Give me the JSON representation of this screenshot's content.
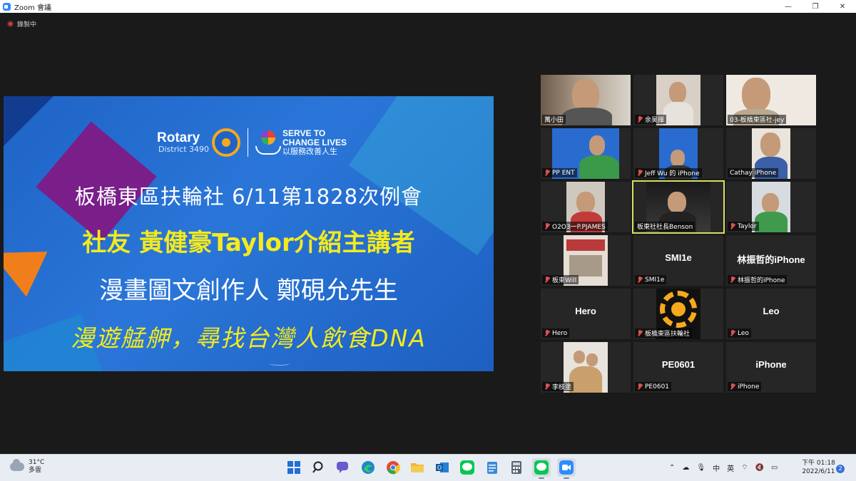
{
  "window": {
    "title": "Zoom 會議",
    "minimize": "—",
    "maximize": "❐",
    "close": "✕"
  },
  "recording": {
    "label": "錄製中"
  },
  "slide": {
    "rotary_name": "Rotary",
    "district": "District 3490",
    "serve_line1": "SERVE TO",
    "serve_line2": "CHANGE LIVES",
    "serve_line3": "以服務改善人生",
    "line1": "板橋東區扶輪社  6/11第1828次例會",
    "line2": "社友 黃健豪Taylor介紹主講者",
    "line3": "漫畫圖文創作人 鄭硯允先生",
    "line4": "漫遊艋舺，尋找台灣人飲食DNA"
  },
  "participants": [
    {
      "name": "萬小田",
      "muted": false,
      "center": ""
    },
    {
      "name": "余昊揮",
      "muted": true,
      "center": ""
    },
    {
      "name": "03-板橋東區社-jey",
      "muted": false,
      "center": ""
    },
    {
      "name": "PP ENT",
      "muted": true,
      "center": ""
    },
    {
      "name": "Jeff Wu 的 iPhone",
      "muted": true,
      "center": ""
    },
    {
      "name": "Cathay iPhone",
      "muted": false,
      "center": ""
    },
    {
      "name": "O2O3一P.PJAMES",
      "muted": true,
      "center": ""
    },
    {
      "name": "板東社社長Benson",
      "muted": false,
      "center": ""
    },
    {
      "name": "Taylor",
      "muted": true,
      "center": ""
    },
    {
      "name": "板東Will",
      "muted": true,
      "center": ""
    },
    {
      "name": "SMI1e",
      "muted": true,
      "center": "SMI1e"
    },
    {
      "name": "林振哲的iPhone",
      "muted": true,
      "center": "林振哲的iPhone"
    },
    {
      "name": "Hero",
      "muted": true,
      "center": "Hero"
    },
    {
      "name": "板橋東區扶輪社",
      "muted": true,
      "center": ""
    },
    {
      "name": "Leo",
      "muted": true,
      "center": "Leo"
    },
    {
      "name": "李枝塗",
      "muted": true,
      "center": ""
    },
    {
      "name": "PE0601",
      "muted": true,
      "center": "PE0601"
    },
    {
      "name": "iPhone",
      "muted": true,
      "center": "iPhone"
    }
  ],
  "taskbar": {
    "temp": "31°C",
    "weather": "多雲",
    "icons": [
      "start-icon",
      "search-icon",
      "chat-icon",
      "edge-icon",
      "chrome-icon",
      "file-explorer-icon",
      "outlook-icon",
      "line-icon",
      "notepad-icon",
      "calculator-icon",
      "line-running-icon",
      "zoom-running-icon"
    ],
    "tray_chevron": "⌃",
    "tray_lang": "中",
    "tray_ime": "英",
    "time": "下午 01:18",
    "date": "2022/6/11",
    "notifications": "2"
  },
  "colors": {
    "accent": "#2d8cff",
    "slide_yellow": "#f4ea1e",
    "active_speaker": "#d8e05c"
  }
}
